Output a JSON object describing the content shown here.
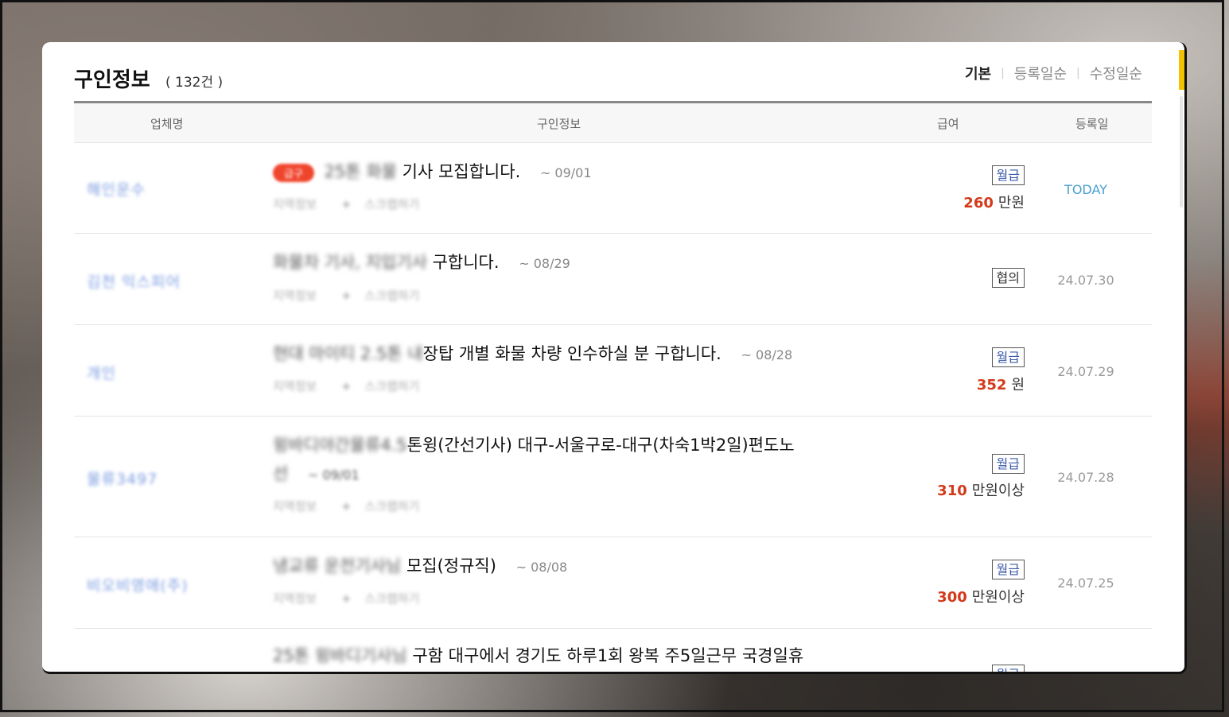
{
  "page": {
    "title": "구인정보",
    "count": "( 132건 )",
    "sort": [
      "기본",
      "등록일순",
      "수정일순"
    ]
  },
  "columns": [
    "업체명",
    "구인정보",
    "급여",
    "등록일"
  ],
  "rows": [
    {
      "company": "해인운수",
      "badge": "급구",
      "title_blur": "25톤 화물",
      "title": "기사 모집합니다.",
      "deadline": "~ 09/01",
      "meta_left": "지역정보",
      "meta_right": "스크랩하기",
      "pay_type": "월급",
      "pay_amount": "260",
      "pay_unit": "만원",
      "date": "TODAY"
    },
    {
      "company": "김천 익스피어",
      "title_blur": "화물차 기사, 지입기사",
      "title": "구합니다.",
      "deadline": "~ 08/29",
      "meta_left": "지역정보",
      "meta_right": "스크랩하기",
      "pay_type": "협의",
      "date": "24.07.30"
    },
    {
      "company": "개인",
      "title_blur": "현대 마이티 2.5톤 내",
      "title": "장탑 개별 화물 차량 인수하실 분 구합니다.",
      "deadline": "~ 08/28",
      "meta_left": "지역정보",
      "meta_right": "스크랩하기",
      "pay_type": "월급",
      "pay_amount": "352",
      "pay_unit": "원",
      "date": "24.07.29"
    },
    {
      "company": "물류3497",
      "title_blur": "윙바디야간물류4.5",
      "title": "톤윙(간선기사) 대구-서울구로-대구(차숙1박2일)편도노",
      "title_line2": "선",
      "deadline": "~ 09/01",
      "meta_left": "지역정보",
      "meta_right": "스크랩하기",
      "pay_type": "월급",
      "pay_amount": "310",
      "pay_unit": "만원이상",
      "date": "24.07.28"
    },
    {
      "company": "비오비영애(주)",
      "title_blur": "냉교류 운전기사님",
      "title": "모집(정규직)",
      "deadline": "~ 08/08",
      "meta_left": "지역정보",
      "meta_right": "스크랩하기",
      "pay_type": "월급",
      "pay_amount": "300",
      "pay_unit": "만원이상",
      "date": "24.07.25"
    },
    {
      "title_blur": "25톤 윙바디기사님",
      "title": "구함 대구에서 경기도 하루1회 왕복 주5일근무 국경일휴",
      "pay_type": "월급"
    }
  ]
}
